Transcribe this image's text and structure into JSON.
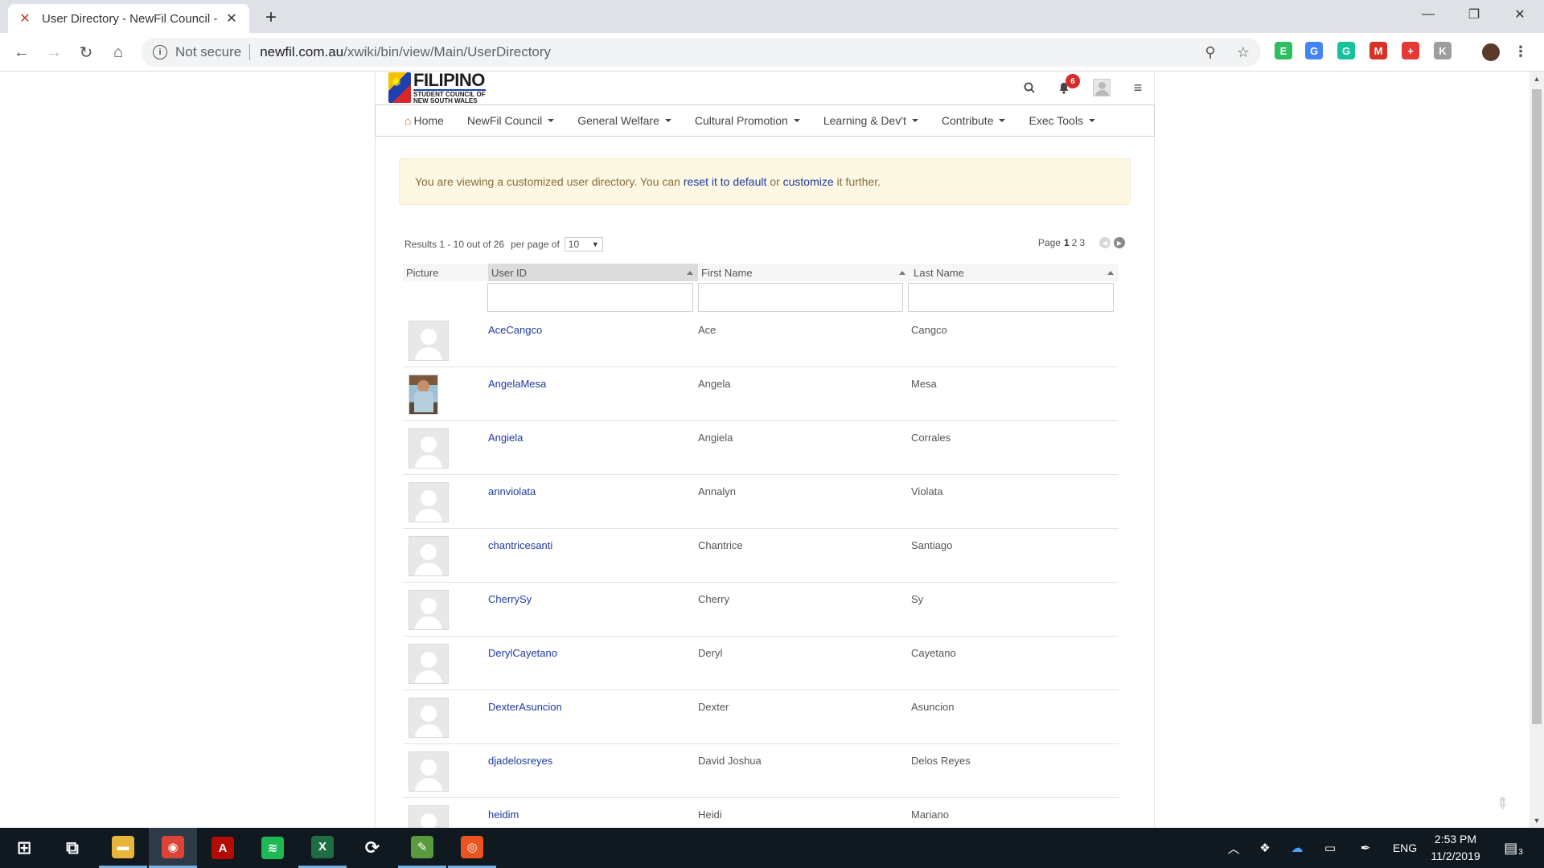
{
  "browser": {
    "tab_title": "User Directory - NewFil Council -",
    "tab_close": "✕",
    "new_tab": "+",
    "not_secure": "Not secure",
    "url_domain": "newfil.com.au",
    "url_path": "/xwiki/bin/view/Main/UserDirectory",
    "window_controls": [
      "minimize-icon",
      "restore-icon",
      "close-icon"
    ],
    "extensions": [
      {
        "name": "evernote-icon",
        "color": "#2dbe60",
        "glyph": "E"
      },
      {
        "name": "google-translate-icon",
        "color": "#4285f4",
        "glyph": "G"
      },
      {
        "name": "grammarly-icon",
        "color": "#15c39a",
        "glyph": "G"
      },
      {
        "name": "extension-red-icon",
        "color": "#d93025",
        "glyph": "M"
      },
      {
        "name": "extension-cross-icon",
        "color": "#e53935",
        "glyph": "+"
      },
      {
        "name": "extension-gray-icon",
        "color": "#9e9e9e",
        "glyph": "K"
      }
    ]
  },
  "site": {
    "logo_main": "FILIPINO",
    "logo_sub1": "STUDENT COUNCIL OF",
    "logo_sub2": "NEW SOUTH WALES",
    "notification_count": "6",
    "nav": [
      {
        "label": "Home",
        "caret": false
      },
      {
        "label": "NewFil Council",
        "caret": true
      },
      {
        "label": "General Welfare",
        "caret": true
      },
      {
        "label": "Cultural Promotion",
        "caret": true
      },
      {
        "label": "Learning & Dev't",
        "caret": true
      },
      {
        "label": "Contribute",
        "caret": true
      },
      {
        "label": "Exec Tools",
        "caret": true
      }
    ]
  },
  "notice": {
    "text_1": "You are viewing a customized user directory. You can ",
    "link_reset": "reset it to default",
    "text_2": " or ",
    "link_customize": "customize",
    "text_3": " it further."
  },
  "table": {
    "results_text": "Results 1 - 10 out of 26",
    "per_page_label": "per page of",
    "per_page_value": "10",
    "page_label": "Page",
    "current_page": "1",
    "other_pages": [
      "2",
      "3"
    ],
    "headers": {
      "picture": "Picture",
      "user_id": "User ID",
      "first_name": "First Name",
      "last_name": "Last Name"
    },
    "rows": [
      {
        "user_id": "AceCangco",
        "first_name": "Ace",
        "last_name": "Cangco",
        "photo": false
      },
      {
        "user_id": "AngelaMesa",
        "first_name": "Angela",
        "last_name": "Mesa",
        "photo": true
      },
      {
        "user_id": "Angiela",
        "first_name": "Angiela",
        "last_name": "Corrales",
        "photo": false
      },
      {
        "user_id": "annviolata",
        "first_name": "Annalyn",
        "last_name": "Violata",
        "photo": false
      },
      {
        "user_id": "chantricesanti",
        "first_name": "Chantrice",
        "last_name": "Santiago",
        "photo": false
      },
      {
        "user_id": "CherrySy",
        "first_name": "Cherry",
        "last_name": "Sy",
        "photo": false
      },
      {
        "user_id": "DerylCayetano",
        "first_name": "Deryl",
        "last_name": "Cayetano",
        "photo": false
      },
      {
        "user_id": "DexterAsuncion",
        "first_name": "Dexter",
        "last_name": "Asuncion",
        "photo": false
      },
      {
        "user_id": "djadelosreyes",
        "first_name": "David Joshua",
        "last_name": "Delos Reyes",
        "photo": false
      },
      {
        "user_id": "heidim",
        "first_name": "Heidi",
        "last_name": "Mariano",
        "photo": false
      }
    ]
  },
  "taskbar": {
    "apps": [
      {
        "name": "start-icon",
        "glyph": "⊞",
        "color": "transparent",
        "state": ""
      },
      {
        "name": "task-view-icon",
        "glyph": "⧉",
        "color": "transparent",
        "state": ""
      },
      {
        "name": "file-explorer-icon",
        "glyph": "▬",
        "color": "#e8b43a",
        "state": "open"
      },
      {
        "name": "chrome-icon",
        "glyph": "◉",
        "color": "#db4437",
        "state": "active"
      },
      {
        "name": "acrobat-icon",
        "glyph": "A",
        "color": "#b30b00",
        "state": ""
      },
      {
        "name": "spotify-icon",
        "glyph": "≋",
        "color": "#1db954",
        "state": ""
      },
      {
        "name": "excel-icon",
        "glyph": "X",
        "color": "#1d6f42",
        "state": "open"
      },
      {
        "name": "sync-icon",
        "glyph": "⟳",
        "color": "transparent",
        "state": ""
      },
      {
        "name": "notepad-icon",
        "glyph": "✎",
        "color": "#5a9a3c",
        "state": "open"
      },
      {
        "name": "ubuntu-icon",
        "glyph": "◎",
        "color": "#e95420",
        "state": "open"
      }
    ],
    "language": "ENG",
    "time": "2:53 PM",
    "date": "11/2/2019",
    "notification_count": "3"
  }
}
